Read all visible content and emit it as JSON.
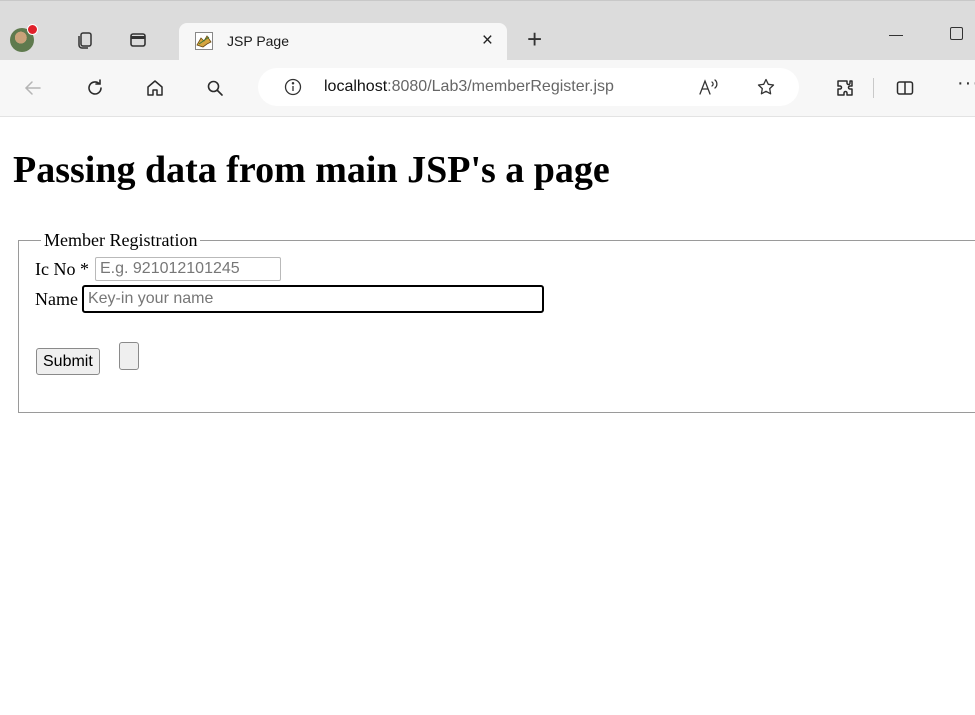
{
  "browser": {
    "tab": {
      "title": "JSP Page",
      "close_glyph": "×",
      "favicon": "tomcat-favicon"
    },
    "new_tab_glyph": "+",
    "address": {
      "host": "localhost",
      "path": ":8080/Lab3/memberRegister.jsp"
    },
    "more_glyph": "···",
    "colors": {
      "tabbar": "#dcdcdc",
      "toolbar": "#f7f7f7",
      "profile_badge": "#e0212b"
    }
  },
  "page": {
    "heading": "Passing data from main JSP's a page",
    "form": {
      "legend": "Member Registration",
      "ic_label": "Ic No *",
      "ic_placeholder": "E.g. 921012101245",
      "name_label": "Name",
      "name_placeholder": "Key-in your name",
      "submit_label": "Submit"
    }
  }
}
